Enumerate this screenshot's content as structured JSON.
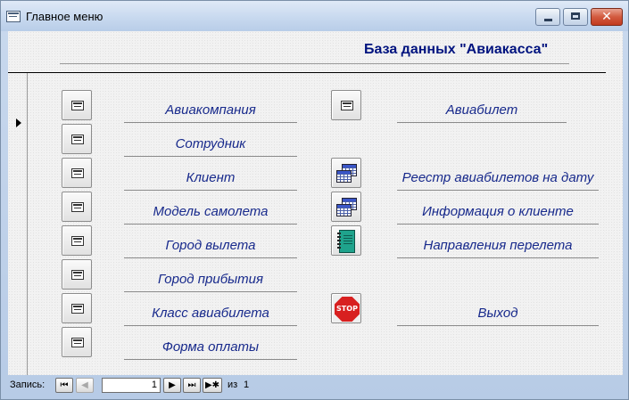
{
  "window": {
    "title": "Главное меню"
  },
  "form": {
    "title": "База данных \"Авиакасса\"",
    "left_items": [
      {
        "label": "Авиакомпания",
        "icon": "form-icon"
      },
      {
        "label": "Сотрудник",
        "icon": "form-icon"
      },
      {
        "label": "Клиент",
        "icon": "form-icon"
      },
      {
        "label": "Модель самолета",
        "icon": "form-icon"
      },
      {
        "label": "Город вылета",
        "icon": "form-icon"
      },
      {
        "label": "Город прибытия",
        "icon": "form-icon"
      },
      {
        "label": "Класс авиабилета",
        "icon": "form-icon"
      },
      {
        "label": "Форма оплаты",
        "icon": "form-icon"
      }
    ],
    "right_items": [
      {
        "label": "Авиабилет",
        "icon": "form-icon"
      },
      {
        "label": "Реестр авиабилетов на дату",
        "icon": "report-icon"
      },
      {
        "label": "Информация о клиенте",
        "icon": "report-icon"
      },
      {
        "label": "Направления перелета",
        "icon": "notebook-icon"
      },
      {
        "label": "Выход",
        "icon": "stop-icon",
        "icon_text": "STOP"
      }
    ]
  },
  "navigation": {
    "label": "Запись:",
    "current": "1",
    "of_label": "из",
    "total": "1",
    "first_icon": "first-record-icon",
    "prev_icon": "prev-record-icon",
    "next_icon": "next-record-icon",
    "last_icon": "last-record-icon",
    "new_icon": "new-record-icon"
  },
  "colors": {
    "label_text": "#182a8c",
    "title_text": "#00137f",
    "close_button": "#c23a1f",
    "stop_sign": "#d82020"
  }
}
